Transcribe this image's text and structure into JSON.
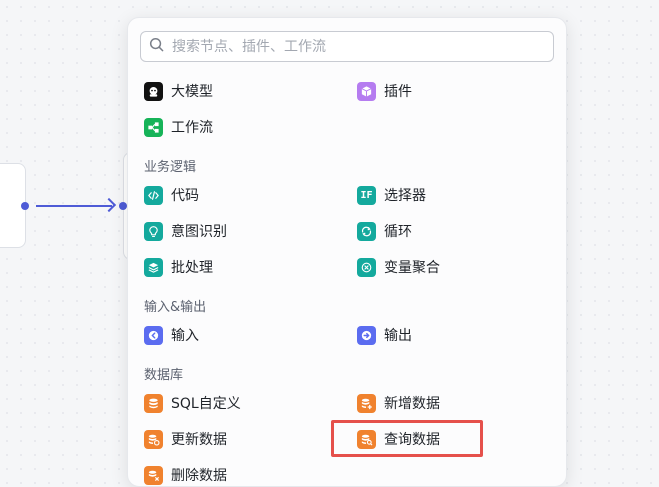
{
  "search": {
    "placeholder": "搜索节点、插件、工作流"
  },
  "top_items": [
    {
      "label": "大模型",
      "icon": "llm-icon",
      "color": "#111111"
    },
    {
      "label": "插件",
      "icon": "plugin-cube-icon",
      "color": "#b57cf0"
    },
    {
      "label": "工作流",
      "icon": "workflow-icon",
      "color": "#16b358"
    }
  ],
  "sections": [
    {
      "title": "业务逻辑",
      "items": [
        {
          "label": "代码",
          "icon": "code-icon",
          "color": "#14a99d"
        },
        {
          "label": "选择器",
          "icon": "if-selector-icon",
          "color": "#14a99d",
          "glyph": "IF"
        },
        {
          "label": "意图识别",
          "icon": "intent-bulb-icon",
          "color": "#14a99d"
        },
        {
          "label": "循环",
          "icon": "loop-icon",
          "color": "#14a99d"
        },
        {
          "label": "批处理",
          "icon": "batch-layers-icon",
          "color": "#14a99d"
        },
        {
          "label": "变量聚合",
          "icon": "variable-merge-icon",
          "color": "#14a99d"
        }
      ]
    },
    {
      "title": "输入&输出",
      "items": [
        {
          "label": "输入",
          "icon": "input-icon",
          "color": "#5b6cf0"
        },
        {
          "label": "输出",
          "icon": "output-icon",
          "color": "#5b6cf0"
        }
      ]
    },
    {
      "title": "数据库",
      "items": [
        {
          "label": "SQL自定义",
          "icon": "database-sql-icon",
          "color": "#f0822e"
        },
        {
          "label": "新增数据",
          "icon": "database-add-icon",
          "color": "#f0822e"
        },
        {
          "label": "更新数据",
          "icon": "database-update-icon",
          "color": "#f0822e"
        },
        {
          "label": "查询数据",
          "icon": "database-query-icon",
          "color": "#f0822e"
        },
        {
          "label": "删除数据",
          "icon": "database-delete-icon",
          "color": "#f0822e"
        }
      ]
    }
  ]
}
